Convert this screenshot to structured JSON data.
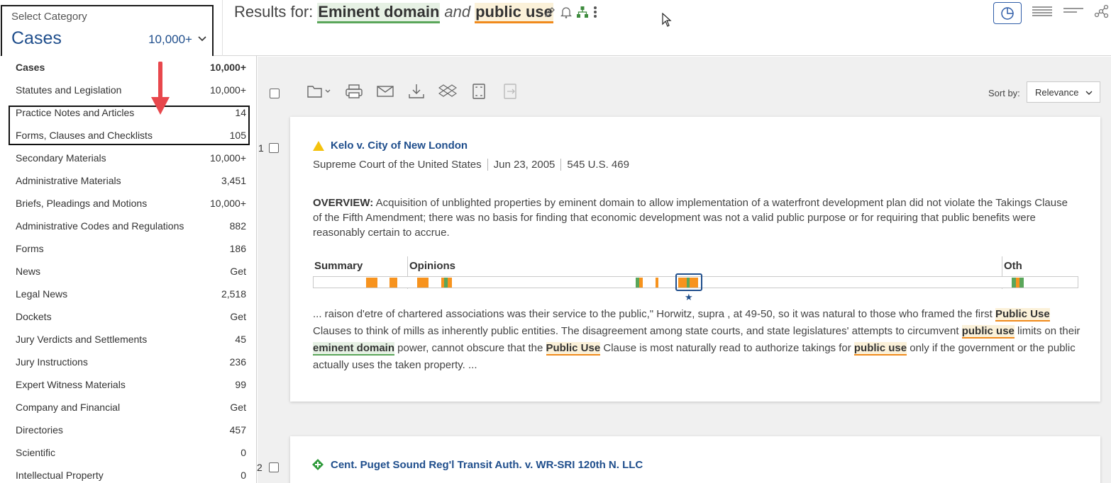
{
  "category_selector": {
    "label": "Select Category",
    "value": "Cases",
    "count": "10,000+"
  },
  "search": {
    "prefix": "Results for:",
    "term1": "Eminent domain",
    "connector": "and",
    "term2": "public use"
  },
  "categories": [
    {
      "name": "Cases",
      "count": "10,000+"
    },
    {
      "name": "Statutes and Legislation",
      "count": "10,000+"
    },
    {
      "name": "Practice Notes and Articles",
      "count": "14"
    },
    {
      "name": "Forms, Clauses and Checklists",
      "count": "105"
    },
    {
      "name": "Secondary Materials",
      "count": "10,000+"
    },
    {
      "name": "Administrative Materials",
      "count": "3,451"
    },
    {
      "name": "Briefs, Pleadings and Motions",
      "count": "10,000+"
    },
    {
      "name": "Administrative Codes and Regulations",
      "count": "882"
    },
    {
      "name": "Forms",
      "count": "186"
    },
    {
      "name": "News",
      "count": "Get"
    },
    {
      "name": "Legal News",
      "count": "2,518"
    },
    {
      "name": "Dockets",
      "count": "Get"
    },
    {
      "name": "Jury Verdicts and Settlements",
      "count": "45"
    },
    {
      "name": "Jury Instructions",
      "count": "236"
    },
    {
      "name": "Expert Witness Materials",
      "count": "99"
    },
    {
      "name": "Company and Financial",
      "count": "Get"
    },
    {
      "name": "Directories",
      "count": "457"
    },
    {
      "name": "Scientific",
      "count": "0"
    },
    {
      "name": "Intellectual Property",
      "count": "0"
    }
  ],
  "sort": {
    "label": "Sort by:",
    "value": "Relevance"
  },
  "results": [
    {
      "number": "1",
      "title": "Kelo v. City of New London",
      "flag": "yellow-warning",
      "court": "Supreme Court of the United States",
      "date": "Jun 23, 2005",
      "citation": "545 U.S. 469",
      "overview_label": "OVERVIEW:",
      "overview": "Acquisition of unblighted properties by eminent domain to allow implementation of a waterfront development plan did not violate the Takings Clause of the Fifth Amendment; there was no basis for finding that economic development was not a valid public purpose or for requiring that public benefits were reasonably certain to accrue.",
      "segments": {
        "summary": "Summary",
        "opinions": "Opinions",
        "other": "Oth"
      },
      "snippet": {
        "part1": "... raison d'etre of chartered associations was their service to the public,\" Horwitz, supra , at 49-50, so it was natural to those who framed the first ",
        "hl1": "Public Use",
        "part2": " Clauses to think of mills as inherently public entities. The disagreement among state courts, and state legislatures' attempts to circumvent ",
        "hl2": "public use",
        "part3": " limits on their ",
        "hl3": "eminent domain",
        "part4": " power, cannot obscure that the ",
        "hl4": "Public Use",
        "part5": " Clause is most naturally read to authorize takings for ",
        "hl5": "public use",
        "part6": " only if the government or the public actually uses the taken property. ..."
      }
    },
    {
      "number": "2",
      "title": "Cent. Puget Sound Reg'l Transit Auth. v. WR-SRI 120th N. LLC",
      "flag": "green-plus"
    }
  ],
  "colors": {
    "link_blue": "#1f4e8c",
    "term_orange": "#f7931e",
    "term_green": "#5aa65a",
    "annotation_red": "#e8474c"
  }
}
